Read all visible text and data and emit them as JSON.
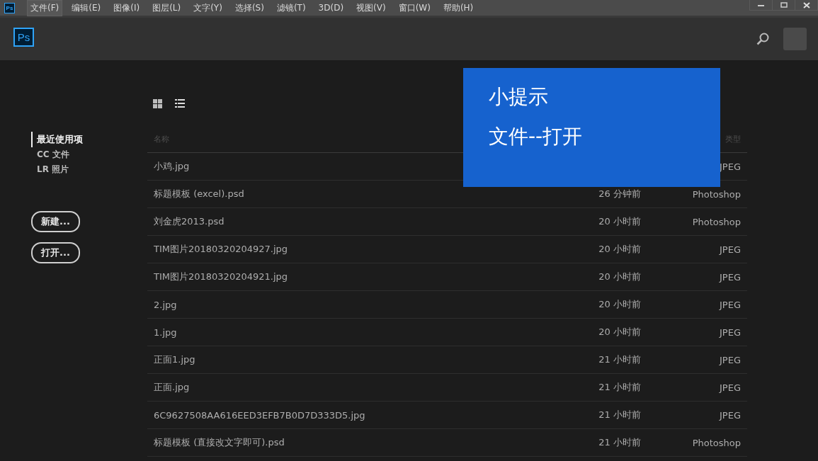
{
  "titlebar": {
    "app_icon": "Ps"
  },
  "menu": [
    {
      "label": "文件(F)",
      "selected": true
    },
    {
      "label": "编辑(E)",
      "selected": false
    },
    {
      "label": "图像(I)",
      "selected": false
    },
    {
      "label": "图层(L)",
      "selected": false
    },
    {
      "label": "文字(Y)",
      "selected": false
    },
    {
      "label": "选择(S)",
      "selected": false
    },
    {
      "label": "滤镜(T)",
      "selected": false
    },
    {
      "label": "3D(D)",
      "selected": false
    },
    {
      "label": "视图(V)",
      "selected": false
    },
    {
      "label": "窗口(W)",
      "selected": false
    },
    {
      "label": "帮助(H)",
      "selected": false
    }
  ],
  "header": {
    "app_icon": "Ps"
  },
  "sidebar": {
    "items": [
      {
        "label": "最近使用项",
        "selected": true
      },
      {
        "label": "CC 文件",
        "selected": false
      },
      {
        "label": "LR 照片",
        "selected": false
      }
    ],
    "buttons": [
      "新建...",
      "打开..."
    ]
  },
  "table": {
    "columns": [
      {
        "kind": "name",
        "label": "名称"
      },
      {
        "kind": "type",
        "label": "类型"
      }
    ],
    "rows": [
      {
        "name": "小鸡.jpg",
        "type": "JPEG"
      },
      {
        "name": "标题模板 (excel).psd",
        "time": "26 分钟前",
        "type": "Photoshop"
      },
      {
        "name": "刘金虎2013.psd",
        "time": "20 小时前",
        "type": "Photoshop"
      },
      {
        "name": "TIM图片20180320204927.jpg",
        "time": "20 小时前",
        "type": "JPEG"
      },
      {
        "name": "TIM图片20180320204921.jpg",
        "time": "20 小时前",
        "type": "JPEG"
      },
      {
        "name": "2.jpg",
        "time": "20 小时前",
        "type": "JPEG"
      },
      {
        "name": "1.jpg",
        "time": "20 小时前",
        "type": "JPEG"
      },
      {
        "name": "正面1.jpg",
        "time": "21 小时前",
        "type": "JPEG"
      },
      {
        "name": "正面.jpg",
        "time": "21 小时前",
        "type": "JPEG"
      },
      {
        "name": "6C9627508AA616EED3EFB7B0D7D333D5.jpg",
        "time": "21 小时前",
        "type": "JPEG"
      },
      {
        "name": "标题模板 (直接改文字即可).psd",
        "time": "21 小时前",
        "type": "Photoshop"
      }
    ]
  },
  "tip": {
    "title": "小提示",
    "text": "文件--打开"
  }
}
